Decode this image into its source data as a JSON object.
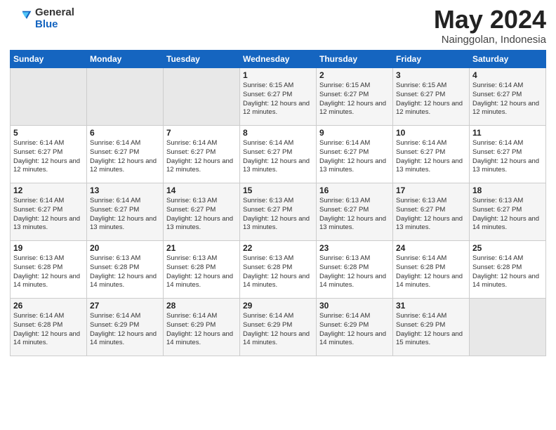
{
  "logo": {
    "general": "General",
    "blue": "Blue"
  },
  "title": {
    "month_year": "May 2024",
    "location": "Nainggolan, Indonesia"
  },
  "weekdays": [
    "Sunday",
    "Monday",
    "Tuesday",
    "Wednesday",
    "Thursday",
    "Friday",
    "Saturday"
  ],
  "weeks": [
    [
      {
        "day": "",
        "sunrise": "",
        "sunset": "",
        "daylight": ""
      },
      {
        "day": "",
        "sunrise": "",
        "sunset": "",
        "daylight": ""
      },
      {
        "day": "",
        "sunrise": "",
        "sunset": "",
        "daylight": ""
      },
      {
        "day": "1",
        "sunrise": "Sunrise: 6:15 AM",
        "sunset": "Sunset: 6:27 PM",
        "daylight": "Daylight: 12 hours and 12 minutes."
      },
      {
        "day": "2",
        "sunrise": "Sunrise: 6:15 AM",
        "sunset": "Sunset: 6:27 PM",
        "daylight": "Daylight: 12 hours and 12 minutes."
      },
      {
        "day": "3",
        "sunrise": "Sunrise: 6:15 AM",
        "sunset": "Sunset: 6:27 PM",
        "daylight": "Daylight: 12 hours and 12 minutes."
      },
      {
        "day": "4",
        "sunrise": "Sunrise: 6:14 AM",
        "sunset": "Sunset: 6:27 PM",
        "daylight": "Daylight: 12 hours and 12 minutes."
      }
    ],
    [
      {
        "day": "5",
        "sunrise": "Sunrise: 6:14 AM",
        "sunset": "Sunset: 6:27 PM",
        "daylight": "Daylight: 12 hours and 12 minutes."
      },
      {
        "day": "6",
        "sunrise": "Sunrise: 6:14 AM",
        "sunset": "Sunset: 6:27 PM",
        "daylight": "Daylight: 12 hours and 12 minutes."
      },
      {
        "day": "7",
        "sunrise": "Sunrise: 6:14 AM",
        "sunset": "Sunset: 6:27 PM",
        "daylight": "Daylight: 12 hours and 12 minutes."
      },
      {
        "day": "8",
        "sunrise": "Sunrise: 6:14 AM",
        "sunset": "Sunset: 6:27 PM",
        "daylight": "Daylight: 12 hours and 13 minutes."
      },
      {
        "day": "9",
        "sunrise": "Sunrise: 6:14 AM",
        "sunset": "Sunset: 6:27 PM",
        "daylight": "Daylight: 12 hours and 13 minutes."
      },
      {
        "day": "10",
        "sunrise": "Sunrise: 6:14 AM",
        "sunset": "Sunset: 6:27 PM",
        "daylight": "Daylight: 12 hours and 13 minutes."
      },
      {
        "day": "11",
        "sunrise": "Sunrise: 6:14 AM",
        "sunset": "Sunset: 6:27 PM",
        "daylight": "Daylight: 12 hours and 13 minutes."
      }
    ],
    [
      {
        "day": "12",
        "sunrise": "Sunrise: 6:14 AM",
        "sunset": "Sunset: 6:27 PM",
        "daylight": "Daylight: 12 hours and 13 minutes."
      },
      {
        "day": "13",
        "sunrise": "Sunrise: 6:14 AM",
        "sunset": "Sunset: 6:27 PM",
        "daylight": "Daylight: 12 hours and 13 minutes."
      },
      {
        "day": "14",
        "sunrise": "Sunrise: 6:13 AM",
        "sunset": "Sunset: 6:27 PM",
        "daylight": "Daylight: 12 hours and 13 minutes."
      },
      {
        "day": "15",
        "sunrise": "Sunrise: 6:13 AM",
        "sunset": "Sunset: 6:27 PM",
        "daylight": "Daylight: 12 hours and 13 minutes."
      },
      {
        "day": "16",
        "sunrise": "Sunrise: 6:13 AM",
        "sunset": "Sunset: 6:27 PM",
        "daylight": "Daylight: 12 hours and 13 minutes."
      },
      {
        "day": "17",
        "sunrise": "Sunrise: 6:13 AM",
        "sunset": "Sunset: 6:27 PM",
        "daylight": "Daylight: 12 hours and 13 minutes."
      },
      {
        "day": "18",
        "sunrise": "Sunrise: 6:13 AM",
        "sunset": "Sunset: 6:27 PM",
        "daylight": "Daylight: 12 hours and 14 minutes."
      }
    ],
    [
      {
        "day": "19",
        "sunrise": "Sunrise: 6:13 AM",
        "sunset": "Sunset: 6:28 PM",
        "daylight": "Daylight: 12 hours and 14 minutes."
      },
      {
        "day": "20",
        "sunrise": "Sunrise: 6:13 AM",
        "sunset": "Sunset: 6:28 PM",
        "daylight": "Daylight: 12 hours and 14 minutes."
      },
      {
        "day": "21",
        "sunrise": "Sunrise: 6:13 AM",
        "sunset": "Sunset: 6:28 PM",
        "daylight": "Daylight: 12 hours and 14 minutes."
      },
      {
        "day": "22",
        "sunrise": "Sunrise: 6:13 AM",
        "sunset": "Sunset: 6:28 PM",
        "daylight": "Daylight: 12 hours and 14 minutes."
      },
      {
        "day": "23",
        "sunrise": "Sunrise: 6:13 AM",
        "sunset": "Sunset: 6:28 PM",
        "daylight": "Daylight: 12 hours and 14 minutes."
      },
      {
        "day": "24",
        "sunrise": "Sunrise: 6:14 AM",
        "sunset": "Sunset: 6:28 PM",
        "daylight": "Daylight: 12 hours and 14 minutes."
      },
      {
        "day": "25",
        "sunrise": "Sunrise: 6:14 AM",
        "sunset": "Sunset: 6:28 PM",
        "daylight": "Daylight: 12 hours and 14 minutes."
      }
    ],
    [
      {
        "day": "26",
        "sunrise": "Sunrise: 6:14 AM",
        "sunset": "Sunset: 6:28 PM",
        "daylight": "Daylight: 12 hours and 14 minutes."
      },
      {
        "day": "27",
        "sunrise": "Sunrise: 6:14 AM",
        "sunset": "Sunset: 6:29 PM",
        "daylight": "Daylight: 12 hours and 14 minutes."
      },
      {
        "day": "28",
        "sunrise": "Sunrise: 6:14 AM",
        "sunset": "Sunset: 6:29 PM",
        "daylight": "Daylight: 12 hours and 14 minutes."
      },
      {
        "day": "29",
        "sunrise": "Sunrise: 6:14 AM",
        "sunset": "Sunset: 6:29 PM",
        "daylight": "Daylight: 12 hours and 14 minutes."
      },
      {
        "day": "30",
        "sunrise": "Sunrise: 6:14 AM",
        "sunset": "Sunset: 6:29 PM",
        "daylight": "Daylight: 12 hours and 14 minutes."
      },
      {
        "day": "31",
        "sunrise": "Sunrise: 6:14 AM",
        "sunset": "Sunset: 6:29 PM",
        "daylight": "Daylight: 12 hours and 15 minutes."
      },
      {
        "day": "",
        "sunrise": "",
        "sunset": "",
        "daylight": ""
      }
    ]
  ]
}
